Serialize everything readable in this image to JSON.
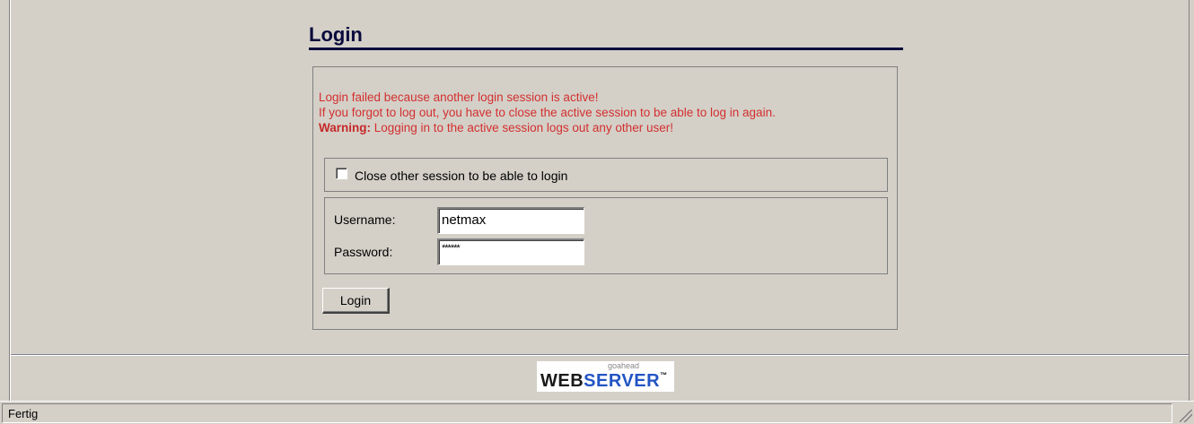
{
  "page": {
    "title": "Login"
  },
  "message": {
    "line1": "Login failed because another login session is active!",
    "line2": "If you forgot to log out, you have to close the active session to be able to log in again.",
    "warning_label": "Warning:",
    "warning_text": " Logging in to the active session logs out any other user!"
  },
  "session": {
    "checkbox_label": "Close other session to be able to login",
    "checked": false
  },
  "form": {
    "username_label": "Username:",
    "username_value": "netmax",
    "password_label": "Password:",
    "password_value": "******",
    "login_button": "Login"
  },
  "footer": {
    "logo_small": "goahead",
    "logo_web": "WEB",
    "logo_server": "SERVER"
  },
  "statusbar": {
    "text": "Fertig"
  },
  "colors": {
    "error_text": "#d32f2f",
    "title": "#0a0a3c",
    "background": "#d4d0c8",
    "logo_accent": "#2255c4"
  }
}
